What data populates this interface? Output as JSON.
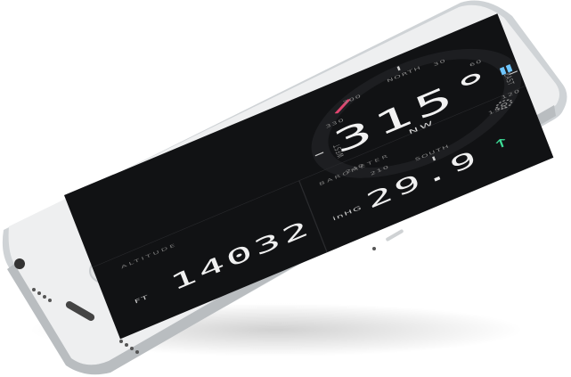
{
  "compass": {
    "heading": "315°",
    "direction": "NW",
    "labels": {
      "west": "WEST",
      "south": "SOUTH",
      "north": "NORTH",
      "east": "EAST",
      "d330": "330",
      "d300": "300",
      "d240": "240",
      "d210": "210",
      "d150": "150",
      "d120": "120",
      "d60": "60",
      "d30": "30"
    }
  },
  "altitude": {
    "title": "ALTITUDE",
    "value": "14032",
    "unit": "FT"
  },
  "barometer": {
    "title": "BAROMETER",
    "value": "29.9",
    "unit": "inHG",
    "trend_symbol": "↑"
  },
  "colors": {
    "screen_bg": "#111214",
    "accent_pink": "#e0456f",
    "accent_blue": "#6ec6ff",
    "trend_green": "#3ddc97",
    "phone_body": "#e9ebec"
  },
  "icons": {
    "settings": "gear-icon",
    "trend": "arrow-up-icon"
  }
}
